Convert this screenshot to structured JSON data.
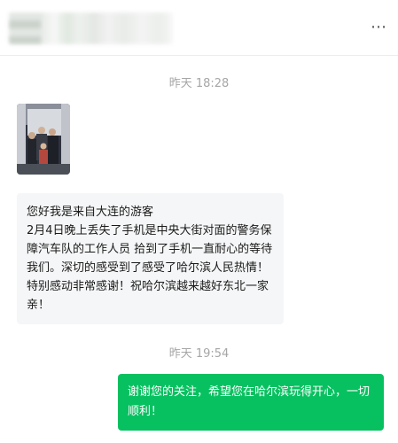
{
  "header": {
    "title": "",
    "more_icon": "⋯"
  },
  "messages": [
    {
      "type": "time",
      "text": "昨天 18:28"
    },
    {
      "type": "image",
      "from": "contact",
      "description_icon": "photo"
    },
    {
      "type": "text",
      "from": "contact",
      "text": "您好我是来自大连的游客\n2月4日晚上丢失了手机是中央大街对面的警务保障汽车队的工作人员 拾到了手机一直耐心的等待我们。深切的感受到了感受了哈尔滨人民热情！特别感动非常感谢！祝哈尔滨越来越好东北一家亲！"
    },
    {
      "type": "time",
      "text": "昨天 19:54"
    },
    {
      "type": "text",
      "from": "me",
      "text": "谢谢您的关注，希望您在哈尔滨玩得开心，一切顺利！"
    }
  ],
  "colors": {
    "outgoing_bubble": "#07c160",
    "incoming_bubble": "#f5f6f7",
    "timestamp": "#a6a6a6"
  }
}
